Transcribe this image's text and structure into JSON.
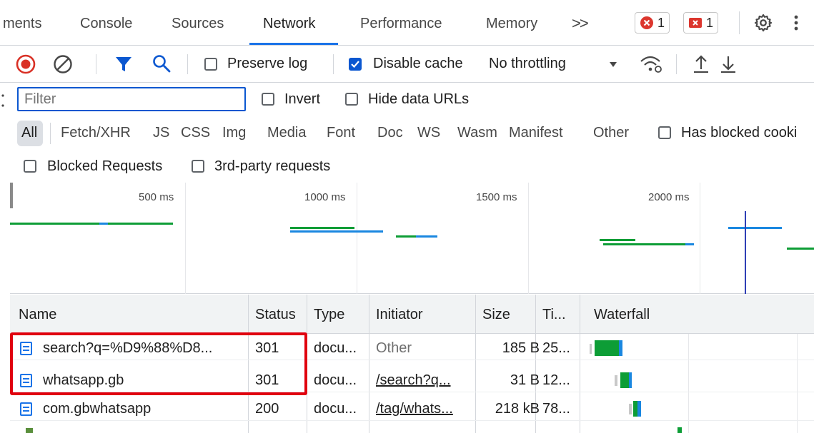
{
  "tabs": [
    {
      "label": "ments",
      "active": false
    },
    {
      "label": "Console",
      "active": false
    },
    {
      "label": "Sources",
      "active": false
    },
    {
      "label": "Network",
      "active": true
    },
    {
      "label": "Performance",
      "active": false
    },
    {
      "label": "Memory",
      "active": false
    }
  ],
  "more_tabs_label": ">>",
  "error_count": "1",
  "issue_count": "1",
  "toolbar": {
    "preserve_log_label": "Preserve log",
    "preserve_log_checked": false,
    "disable_cache_label": "Disable cache",
    "disable_cache_checked": true,
    "throttling_value": "No throttling"
  },
  "filter": {
    "placeholder": "Filter",
    "invert_label": "Invert",
    "hide_data_urls_label": "Hide data URLs",
    "types": [
      "All",
      "Fetch/XHR",
      "JS",
      "CSS",
      "Img",
      "Media",
      "Font",
      "Doc",
      "WS",
      "Wasm",
      "Manifest",
      "Other"
    ],
    "selected_type": "All",
    "has_blocked_cookies_label": "Has blocked cooki",
    "blocked_requests_label": "Blocked Requests",
    "third_party_label": "3rd-party requests"
  },
  "overview": {
    "ticks": [
      "500 ms",
      "1000 ms",
      "1500 ms",
      "2000 ms"
    ]
  },
  "table": {
    "columns": [
      "Name",
      "Status",
      "Type",
      "Initiator",
      "Size",
      "Ti...",
      "Waterfall"
    ],
    "rows": [
      {
        "name": "search?q=%D9%88%D8...",
        "status": "301",
        "type": "docu...",
        "initiator": "Other",
        "initiator_link": false,
        "size": "185 B",
        "time": "25..."
      },
      {
        "name": "whatsapp.gb",
        "status": "301",
        "type": "docu...",
        "initiator": "/search?q...",
        "initiator_link": true,
        "size": "31 B",
        "time": "12..."
      },
      {
        "name": "com.gbwhatsapp",
        "status": "200",
        "type": "docu...",
        "initiator": "/tag/whats...",
        "initiator_link": true,
        "size": "218 kB",
        "time": "78..."
      }
    ]
  },
  "colors": {
    "accent": "#1a73e8",
    "record": "#d93025",
    "highlight": "#e0000f",
    "waiting": "#0d9d36",
    "download": "#1a87e0"
  },
  "icons": [
    "record-stop-icon",
    "clear-icon",
    "filter-icon",
    "search-icon",
    "wifi-settings-icon",
    "upload-icon",
    "download-icon",
    "gear-icon",
    "kebab-menu-icon",
    "error-icon",
    "issue-icon",
    "document-icon"
  ]
}
